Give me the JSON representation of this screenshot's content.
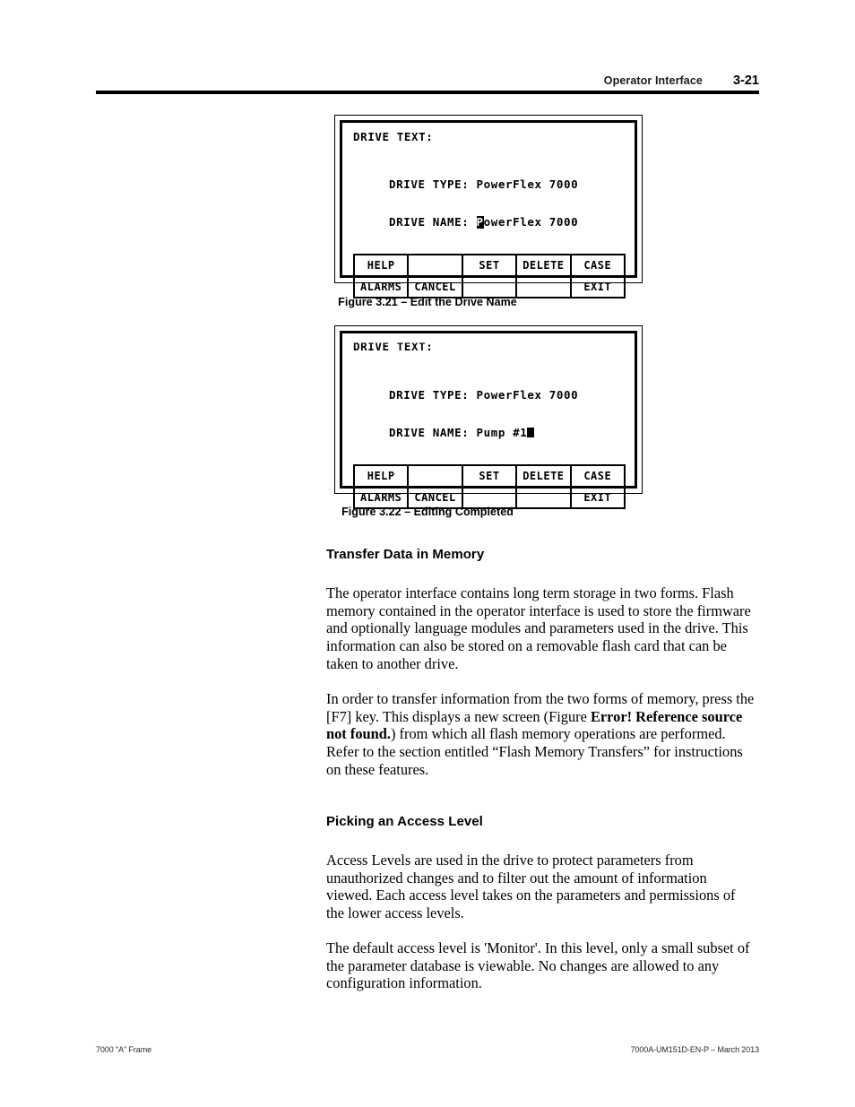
{
  "header": {
    "title": "Operator Interface",
    "page_number": "3-21"
  },
  "figures": [
    {
      "id": "figure-3-21",
      "caption": "Figure 3.21 – Edit the Drive Name",
      "screen": {
        "title": "DRIVE TEXT:",
        "title_clipped": false,
        "rows": [
          {
            "label": "DRIVE TYPE:",
            "value": "PowerFlex 7000"
          },
          {
            "label": "DRIVE NAME:",
            "value": "PowerFlex 7000"
          }
        ],
        "cursor": {
          "mode": "overwrite-first-char",
          "row": 1,
          "char": "P"
        }
      },
      "softkeys": {
        "row1": [
          "HELP",
          "",
          "SET",
          "DELETE",
          "CASE"
        ],
        "row2": [
          "ALARMS",
          "CANCEL",
          "",
          "",
          "EXIT"
        ]
      }
    },
    {
      "id": "figure-3-22",
      "caption": "Figure 3.22 – Editing Completed",
      "screen": {
        "title": "DRIVE TEXT:",
        "title_clipped": true,
        "rows": [
          {
            "label": "DRIVE TYPE:",
            "value": "PowerFlex 7000"
          },
          {
            "label": "DRIVE NAME:",
            "value": "Pump #1"
          }
        ],
        "cursor": {
          "mode": "block-after-text",
          "row": 1,
          "char": ""
        }
      },
      "softkeys": {
        "row1": [
          "HELP",
          "",
          "SET",
          "DELETE",
          "CASE"
        ],
        "row2": [
          "ALARMS",
          "CANCEL",
          "",
          "",
          "EXIT"
        ]
      }
    }
  ],
  "sections": [
    {
      "heading": "Transfer Data in Memory",
      "paragraphs": [
        {
          "text": "The operator interface contains long term storage in two forms.  Flash memory contained in the operator interface is used to store the firmware and optionally language modules and parameters used in the drive.  This information can also be stored on a removable flash card that can be taken to another drive."
        },
        {
          "pre": "In order to transfer information from the two forms of memory, press the [F7] key.  This displays a new screen (Figure ",
          "bold": "Error! Reference source not found.",
          "post": ") from which all flash memory operations are performed.  Refer to the section entitled “Flash Memory Transfers” for instructions on these features."
        }
      ]
    },
    {
      "heading": "Picking an Access Level",
      "paragraphs": [
        {
          "text": "Access Levels are used in the drive to protect parameters from unauthorized changes and to filter out the amount of information viewed.  Each access level takes on the parameters and permissions of the lower access levels."
        },
        {
          "text": "The default access level is 'Monitor'.  In this level, only a small subset of the parameter database is viewable.  No changes are allowed to any configuration information."
        }
      ]
    }
  ],
  "footer": {
    "left": "7000 \"A\" Frame",
    "right": "7000A-UM151D-EN-P – March 2013"
  }
}
